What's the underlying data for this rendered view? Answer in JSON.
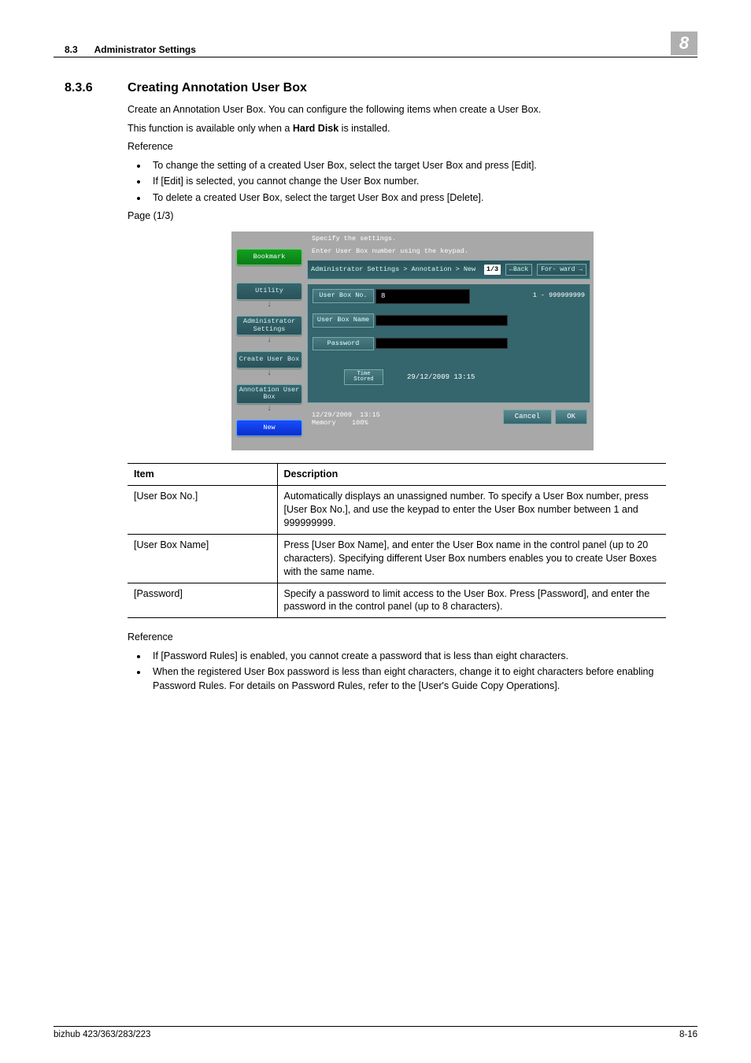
{
  "header": {
    "section_num": "8.3",
    "section_title": "Administrator Settings",
    "chapter_flag": "8"
  },
  "heading": {
    "num": "8.3.6",
    "title": "Creating Annotation User Box"
  },
  "intro1": "Create an Annotation User Box. You can configure the following items when create a User Box.",
  "intro2_pre": "This function is available only when a ",
  "intro2_bold": "Hard Disk",
  "intro2_post": " is installed.",
  "ref1_label": "Reference",
  "ref1_bullets": [
    "To change the setting of a created User Box, select the target User Box and press [Edit].",
    "If [Edit] is selected, you cannot change the User Box number.",
    "To delete a created User Box, select the target User Box and press [Delete]."
  ],
  "page_label": "Page (1/3)",
  "device": {
    "instr_line1": "Specify the settings.",
    "instr_line2": "Enter User Box number using the keypad.",
    "side": {
      "bookmark": "Bookmark",
      "utility": "Utility",
      "admin": "Administrator Settings",
      "createbox": "Create User Box",
      "annot": "Annotation User Box",
      "new": "New"
    },
    "breadcrumb": "Administrator Settings > Annotation > New",
    "page": "1/3",
    "back": "←Back",
    "forward": "For- ward →",
    "fields": {
      "boxno_label": "User Box No.",
      "boxno_val": "8",
      "range": "1 - 999999999",
      "boxname_label": "User Box Name",
      "password_label": "Password",
      "timestored_label": "Time Stored",
      "timestored_val": "29/12/2009  13:15"
    },
    "bottom_date": "12/29/2009",
    "bottom_time": "13:15",
    "bottom_memory_label": "Memory",
    "bottom_memory_val": "100%",
    "cancel": "Cancel",
    "ok": "OK"
  },
  "table": {
    "head_item": "Item",
    "head_desc": "Description",
    "rows": [
      {
        "item": "[User Box No.]",
        "desc": "Automatically displays an unassigned number. To specify a User Box number, press [User Box No.], and use the keypad to enter the User Box number between 1 and 999999999."
      },
      {
        "item": "[User Box Name]",
        "desc": "Press [User Box Name], and enter the User Box name in the control panel (up to 20 characters). Specifying different User Box numbers enables you to create User Boxes with the same name."
      },
      {
        "item": "[Password]",
        "desc": "Specify a password to limit access to the User Box. Press [Password], and enter the password in the control panel (up to 8 characters)."
      }
    ]
  },
  "ref2_label": "Reference",
  "ref2_bullets": [
    "If [Password Rules] is enabled, you cannot create a password that is less than eight characters.",
    "When the registered User Box password is less than eight characters, change it to eight characters before enabling Password Rules. For details on Password Rules, refer to the [User's Guide Copy Operations]."
  ],
  "footer": {
    "left": "bizhub 423/363/283/223",
    "right": "8-16"
  }
}
